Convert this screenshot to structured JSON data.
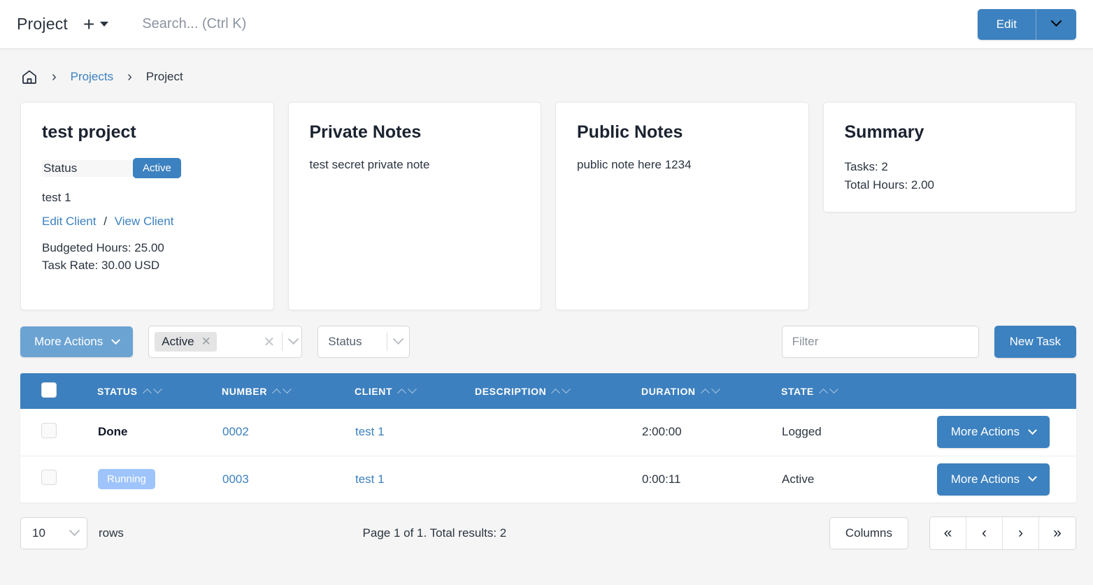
{
  "topbar": {
    "app_title": "Project",
    "add_icon": "plus-icon",
    "add_caret_icon": "caret-down-icon",
    "search_placeholder": "Search... (Ctrl K)",
    "search_value": "",
    "edit_label": "Edit",
    "edit_caret_icon": "chevron-down-icon"
  },
  "breadcrumb": {
    "home_icon": "home-icon",
    "separator": "›",
    "items": [
      {
        "label": "Projects",
        "current": false
      },
      {
        "label": "Project",
        "current": true
      }
    ]
  },
  "cards": {
    "project": {
      "title": "test project",
      "status_label": "Status",
      "status_badge": "Active",
      "client_name": "test 1",
      "edit_client_link": "Edit Client",
      "links_separator": "/",
      "view_client_link": "View Client",
      "budgeted_hours": "Budgeted Hours: 25.00",
      "task_rate": "Task Rate: 30.00 USD"
    },
    "private_notes": {
      "title": "Private Notes",
      "body": "test secret private note"
    },
    "public_notes": {
      "title": "Public Notes",
      "body": "public note here 1234"
    },
    "summary": {
      "title": "Summary",
      "tasks": "Tasks: 2",
      "total_hours": "Total Hours: 2.00"
    }
  },
  "toolbar": {
    "more_actions_label": "More Actions",
    "status_filter_chip": "Active",
    "chip_remove_icon": "close-icon",
    "clear_all_icon": "close-icon",
    "multiselect_caret_icon": "chevron-down-icon",
    "status_select_label": "Status",
    "status_select_caret_icon": "chevron-down-icon",
    "filter_placeholder": "Filter",
    "filter_value": "",
    "new_task_label": "New Task"
  },
  "table": {
    "select_all_checkbox": "",
    "columns": [
      {
        "label": "STATUS"
      },
      {
        "label": "NUMBER"
      },
      {
        "label": "CLIENT"
      },
      {
        "label": "DESCRIPTION"
      },
      {
        "label": "DURATION"
      },
      {
        "label": "STATE"
      }
    ],
    "rows": [
      {
        "status": "Done",
        "status_style": "plain",
        "number": "0002",
        "client": "test 1",
        "description": "",
        "duration": "2:00:00",
        "state": "Logged",
        "action_label": "More Actions"
      },
      {
        "status": "Running",
        "status_style": "badge",
        "number": "0003",
        "client": "test 1",
        "description": "",
        "duration": "0:00:11",
        "state": "Active",
        "action_label": "More Actions"
      }
    ]
  },
  "footer": {
    "rows_per_page": "10",
    "rows_label": "rows",
    "page_info": "Page 1 of 1. Total results: 2",
    "columns_label": "Columns",
    "pager": {
      "first": "«",
      "prev": "‹",
      "next": "›",
      "last": "»"
    }
  },
  "colors": {
    "primary_blue": "#3c81c0",
    "light_blue_button": "#6ba3d3",
    "table_header_blue": "#3d80bf",
    "running_badge_blue": "#9ec4fb",
    "page_background": "#f5f5f5",
    "card_background": "#ffffff",
    "text_dark": "#2b3440"
  }
}
